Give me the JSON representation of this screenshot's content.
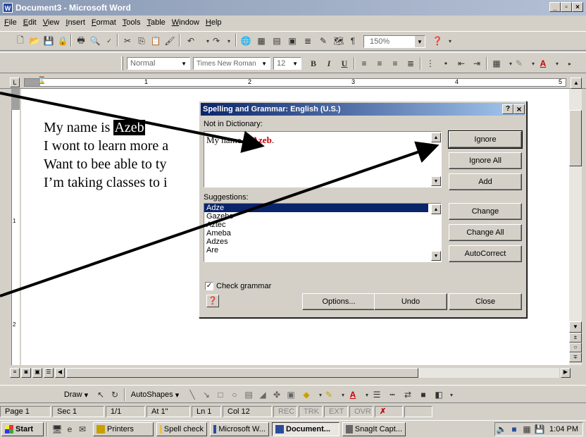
{
  "window": {
    "title": "Document3 - Microsoft Word"
  },
  "menu": [
    "File",
    "Edit",
    "View",
    "Insert",
    "Format",
    "Tools",
    "Table",
    "Window",
    "Help"
  ],
  "toolbar": {
    "zoom": "150%",
    "style": "Normal",
    "font": "Times New Roman",
    "size": "12"
  },
  "ruler": {
    "numbers": [
      "1",
      "2",
      "3",
      "4",
      "5"
    ]
  },
  "document": {
    "lines": [
      "My name is ",
      "I wont to learn more a",
      "Want to bee able to ty",
      "I’m taking classes to i"
    ],
    "highlight": "Azeb"
  },
  "dialog": {
    "title": "Spelling and Grammar: English (U.S.)",
    "help": "?",
    "close": "×",
    "not_in_dict_label": "Not in Dictionary:",
    "sentence_pre": "My name is ",
    "sentence_word": "Azeb",
    "sentence_post": ".",
    "suggestions_label": "Suggestions:",
    "suggestions": [
      "Adze",
      "Gazebo",
      "Aztec",
      "Ameba",
      "Adzes",
      "Are"
    ],
    "check_grammar": "Check grammar",
    "buttons": {
      "ignore": "Ignore",
      "ignore_all": "Ignore All",
      "add": "Add",
      "change": "Change",
      "change_all": "Change All",
      "autocorrect": "AutoCorrect",
      "options": "Options...",
      "undo": "Undo",
      "close": "Close"
    }
  },
  "drawing": {
    "draw": "Draw",
    "autoshapes": "AutoShapes"
  },
  "status": {
    "page": "Page 1",
    "sec": "Sec 1",
    "pages": "1/1",
    "at": "At 1\"",
    "ln": "Ln 1",
    "col": "Col 12",
    "rec": "REC",
    "trk": "TRK",
    "ext": "EXT",
    "ovr": "OVR"
  },
  "taskbar": {
    "start": "Start",
    "items": [
      "Printers",
      "Spell check",
      "Microsoft W...",
      "Document...",
      "SnagIt Capt..."
    ],
    "clock": "1:04 PM"
  }
}
